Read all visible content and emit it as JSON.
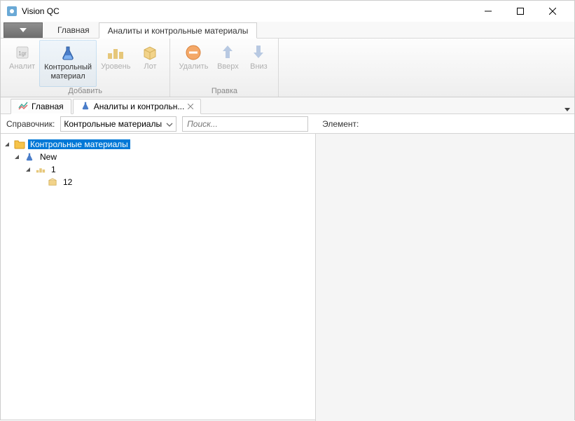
{
  "window": {
    "title": "Vision QC"
  },
  "ribbon": {
    "tabs": {
      "home": "Главная",
      "analytes": "Аналиты и контрольные материалы"
    },
    "buttons": {
      "analyte": "Аналит",
      "control_material": "Контрольный\nматериал",
      "level": "Уровень",
      "lot": "Лот",
      "delete": "Удалить",
      "up": "Вверх",
      "down": "Вниз"
    },
    "groups": {
      "add": "Добавить",
      "edit": "Правка"
    }
  },
  "doc_tabs": {
    "home": "Главная",
    "analytes": "Аналиты и контрольн..."
  },
  "toolbar": {
    "ref_label": "Справочник:",
    "combo_value": "Контрольные материалы",
    "search_placeholder": "Поиск...",
    "element_label": "Элемент:"
  },
  "tree": {
    "root": "Контрольные материалы",
    "n1": "New",
    "n2": "1",
    "n3": "12"
  }
}
